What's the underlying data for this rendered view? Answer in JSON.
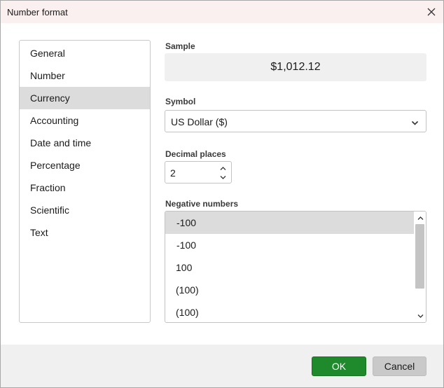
{
  "window": {
    "title": "Number format"
  },
  "categories": {
    "items": [
      "General",
      "Number",
      "Currency",
      "Accounting",
      "Date and time",
      "Percentage",
      "Fraction",
      "Scientific",
      "Text"
    ],
    "selected_index": 2
  },
  "sample": {
    "label": "Sample",
    "value": "$1,012.12"
  },
  "symbol": {
    "label": "Symbol",
    "value": "US Dollar ($)"
  },
  "decimal": {
    "label": "Decimal places",
    "value": "2"
  },
  "negative": {
    "label": "Negative numbers",
    "items": [
      "-100",
      "-100",
      "100",
      "(100)",
      "(100)"
    ],
    "selected_index": 0,
    "colors": [
      "#1a1a1a",
      "#1a1a1a",
      "#1a1a1a",
      "#1a1a1a",
      "#1a1a1a"
    ]
  },
  "buttons": {
    "ok": "OK",
    "cancel": "Cancel"
  },
  "colors": {
    "accent": "#1f8a2c",
    "title_bar": "#fbf0f0",
    "selection": "#dcdcdc"
  }
}
